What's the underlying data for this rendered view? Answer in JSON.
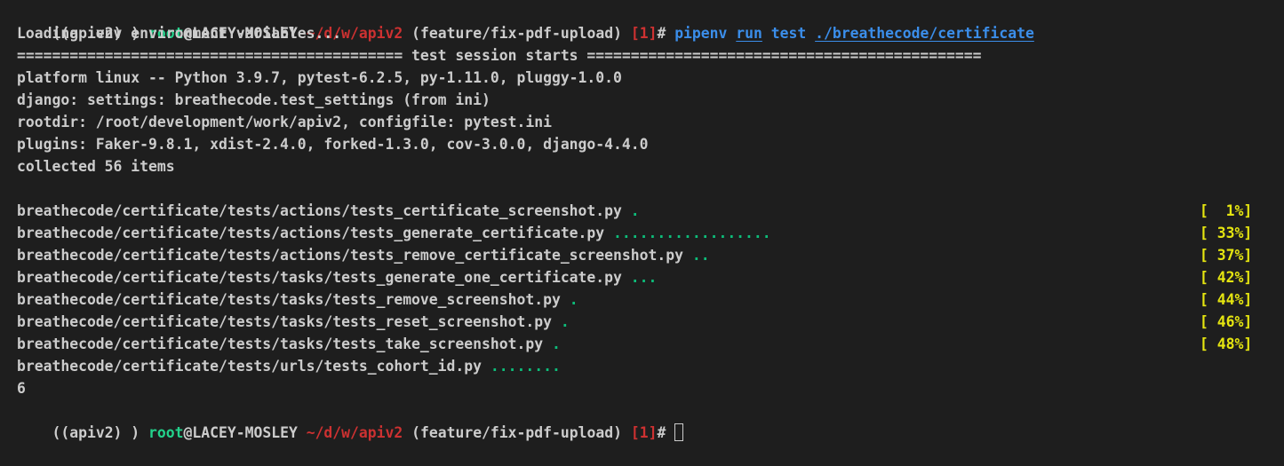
{
  "colors": {
    "background": "#1e1e1e",
    "foreground": "#cccccc",
    "user_green": "#23d18b",
    "path_red": "#cd3131",
    "command_blue": "#3b8eea",
    "pass_dot_green": "#0dbc79",
    "percent_yellow": "#e5e510"
  },
  "prompt1": {
    "env": "((apiv2) ) ",
    "user": "root",
    "host": "@LACEY-MOSLEY",
    "path": " ~/d/w/apiv2",
    "branch": " (feature/fix-pdf-upload) ",
    "status": "[1]",
    "hash": "# ",
    "cmd_pipenv": "pipenv",
    "cmd_run": "run",
    "cmd_test": "test",
    "cmd_arg": "./breathecode/certificate"
  },
  "output": {
    "loading": "Loading .env environment variables...",
    "session_bar": "============================================ test session starts =============================================",
    "platform": "platform linux -- Python 3.9.7, pytest-6.2.5, py-1.11.0, pluggy-1.0.0",
    "django": "django: settings: breathecode.test_settings (from ini)",
    "rootdir": "rootdir: /root/development/work/apiv2, configfile: pytest.ini",
    "plugins": "plugins: Faker-9.8.1, xdist-2.4.0, forked-1.3.0, cov-3.0.0, django-4.4.0",
    "collected": "collected 56 items"
  },
  "tests": [
    {
      "file": "breathecode/certificate/tests/actions/tests_certificate_screenshot.py",
      "dots": ".",
      "percent": "[  1%]"
    },
    {
      "file": "breathecode/certificate/tests/actions/tests_generate_certificate.py",
      "dots": "..................",
      "percent": "[ 33%]"
    },
    {
      "file": "breathecode/certificate/tests/actions/tests_remove_certificate_screenshot.py",
      "dots": "..",
      "percent": "[ 37%]"
    },
    {
      "file": "breathecode/certificate/tests/tasks/tests_generate_one_certificate.py",
      "dots": "...",
      "percent": "[ 42%]"
    },
    {
      "file": "breathecode/certificate/tests/tasks/tests_remove_screenshot.py",
      "dots": ".",
      "percent": "[ 44%]"
    },
    {
      "file": "breathecode/certificate/tests/tasks/tests_reset_screenshot.py",
      "dots": ".",
      "percent": "[ 46%]"
    },
    {
      "file": "breathecode/certificate/tests/tasks/tests_take_screenshot.py",
      "dots": ".",
      "percent": "[ 48%]"
    },
    {
      "file": "breathecode/certificate/tests/urls/tests_cohort_id.py",
      "dots": "........",
      "percent": ""
    }
  ],
  "stray_output": "6",
  "prompt2": {
    "env": "((apiv2) ) ",
    "user": "root",
    "host": "@LACEY-MOSLEY",
    "path": " ~/d/w/apiv2",
    "branch": " (feature/fix-pdf-upload) ",
    "status": "[1]",
    "hash": "# "
  }
}
